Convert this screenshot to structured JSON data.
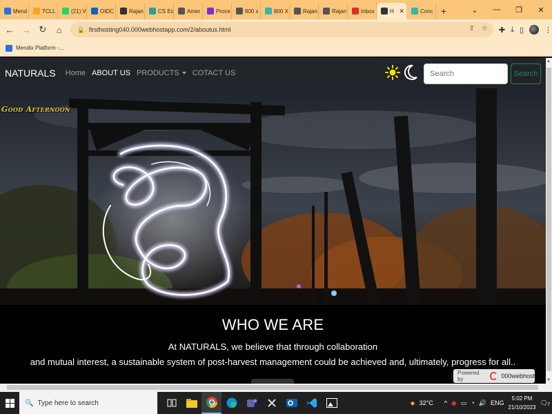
{
  "browser": {
    "tabs": [
      {
        "label": "Mend",
        "color": "#2b6fdf"
      },
      {
        "label": "TCLL",
        "color": "#f5a623"
      },
      {
        "label": "(21) V",
        "color": "#25d366"
      },
      {
        "label": "OIDC",
        "color": "#1a5fb4"
      },
      {
        "label": "Rajan",
        "color": "#333333"
      },
      {
        "label": "CS Ed",
        "color": "#2aa198"
      },
      {
        "label": "Amer",
        "color": "#555555"
      },
      {
        "label": "Proce",
        "color": "#7b2fd1"
      },
      {
        "label": "800 x",
        "color": "#555555"
      },
      {
        "label": "800 X",
        "color": "#3bb3a8"
      },
      {
        "label": "Rajan",
        "color": "#555555"
      },
      {
        "label": "Rajan",
        "color": "#555555"
      },
      {
        "label": "Inbox",
        "color": "#d93025"
      },
      {
        "label": "H",
        "color": "#333333",
        "active": true
      },
      {
        "label": "Conc",
        "color": "#3bb3a8"
      }
    ],
    "new_tab_label": "+",
    "url": "firsthosting040.000webhostapp.com/2/aboutus.html",
    "bookmark_label": "Mendix Platform -..."
  },
  "site": {
    "brand": "NATURALS",
    "nav": {
      "home": "Home",
      "about": "ABOUT US",
      "products": "PRODUCTS",
      "contact": "COTACT US"
    },
    "search": {
      "placeholder": "Search",
      "button": "Search"
    },
    "greeting": "Good Afternoon",
    "who": {
      "heading": "WHO WE ARE",
      "line1": "At NATURALS, we believe that through collaboration",
      "line2": "and mutual interest, a sustainable system of post-harvest management could be achieved and, ultimately, progress for all.."
    },
    "badge": {
      "powered": "Powered by",
      "name": "000webhost"
    }
  },
  "taskbar": {
    "search_placeholder": "Type here to search",
    "weather": "32°C",
    "lang": "ENG",
    "time": "5:02 PM",
    "date": "21/10/2023",
    "notifications": "7"
  }
}
